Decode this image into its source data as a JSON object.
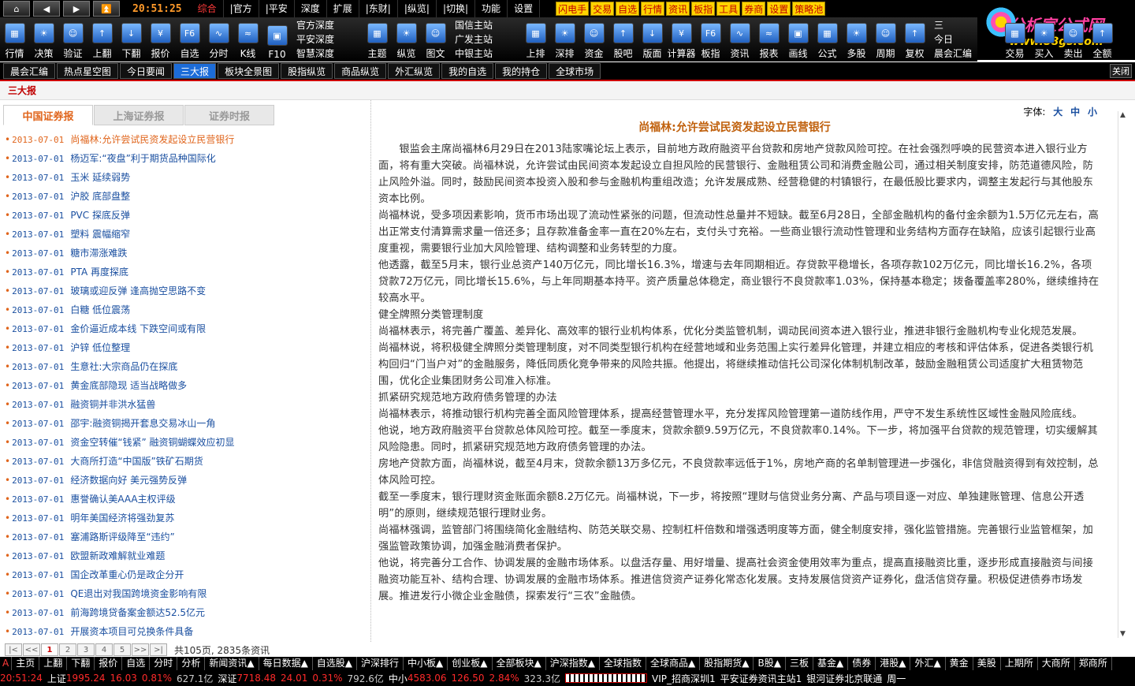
{
  "menubar": {
    "clock": "20:51:25",
    "items": [
      {
        "label": "综合",
        "active": true
      },
      {
        "label": "|官方"
      },
      {
        "label": "|平安"
      },
      {
        "label": "深度"
      },
      {
        "label": "扩展"
      },
      {
        "label": "|东财|"
      },
      {
        "label": "|纵览|"
      },
      {
        "label": "|切换|"
      },
      {
        "label": "功能"
      },
      {
        "label": "设置"
      }
    ],
    "yellow": [
      "闪电手",
      "交易",
      "自选",
      "行情",
      "资讯",
      "板指",
      "工具",
      "券商",
      "设置",
      "策略池"
    ]
  },
  "logo": {
    "line1": "分析家公式网",
    "line2": "www.88gs.com"
  },
  "iconbar": {
    "left": [
      "行情",
      "决策",
      "验证",
      "上翻",
      "下翻",
      "报价",
      "自选",
      "分时",
      "K线",
      "F10"
    ],
    "group1": [
      "官方深度",
      "平安深度",
      "智慧深度"
    ],
    "mid": [
      "主题",
      "纵览",
      "图文"
    ],
    "group2": [
      "国信主站",
      "广发主站",
      "中银主站"
    ],
    "right": [
      "上排",
      "深排",
      "资金",
      "股吧",
      "版面",
      "计算器",
      "板指",
      "资讯",
      "报表",
      "画线",
      "公式",
      "多股",
      "周期",
      "复权"
    ],
    "group3": [
      "三",
      "今日",
      "晨会汇编"
    ],
    "far": [
      "交易",
      "买入",
      "卖出",
      "全额"
    ]
  },
  "tabs": [
    {
      "label": "晨会汇编"
    },
    {
      "label": "热点星空图"
    },
    {
      "label": "今日要闻"
    },
    {
      "label": "三大报",
      "active": true
    },
    {
      "label": "板块全景图"
    },
    {
      "label": "股指纵览"
    },
    {
      "label": "商品纵览"
    },
    {
      "label": "外汇纵览"
    },
    {
      "label": "我的自选"
    },
    {
      "label": "我的持仓"
    },
    {
      "label": "全球市场"
    }
  ],
  "close_label": "关闭",
  "section_title": "三大报",
  "sources": [
    {
      "label": "中国证券报",
      "active": true
    },
    {
      "label": "上海证券报"
    },
    {
      "label": "证券时报"
    }
  ],
  "news": [
    {
      "date": "2013-07-01",
      "title": "尚福林:允许尝试民资发起设立民营银行",
      "active": true
    },
    {
      "date": "2013-07-01",
      "title": "杨迈军:“夜盘”利于期货品种国际化"
    },
    {
      "date": "2013-07-01",
      "title": "玉米 延续弱势"
    },
    {
      "date": "2013-07-01",
      "title": "沪胶 底部盘整"
    },
    {
      "date": "2013-07-01",
      "title": "PVC 探底反弹"
    },
    {
      "date": "2013-07-01",
      "title": "塑料 震幅缩窄"
    },
    {
      "date": "2013-07-01",
      "title": "糖市滞涨难跌"
    },
    {
      "date": "2013-07-01",
      "title": "PTA 再度探底"
    },
    {
      "date": "2013-07-01",
      "title": "玻璃或迎反弹 逢高抛空思路不变"
    },
    {
      "date": "2013-07-01",
      "title": "白糖 低位震荡"
    },
    {
      "date": "2013-07-01",
      "title": "金价逼近成本线 下跌空间或有限"
    },
    {
      "date": "2013-07-01",
      "title": "沪锌 低位整理"
    },
    {
      "date": "2013-07-01",
      "title": "生意社:大宗商品仍在探底"
    },
    {
      "date": "2013-07-01",
      "title": "黄金底部隐现 适当战略做多"
    },
    {
      "date": "2013-07-01",
      "title": "融资铜并非洪水猛兽"
    },
    {
      "date": "2013-07-01",
      "title": "邵宇:融资铜揭开套息交易冰山一角"
    },
    {
      "date": "2013-07-01",
      "title": "资金空转催“钱紧” 融资铜蝴蝶效应初显"
    },
    {
      "date": "2013-07-01",
      "title": "大商所打造“中国版”铁矿石期货"
    },
    {
      "date": "2013-07-01",
      "title": "经济数据向好 美元强势反弹"
    },
    {
      "date": "2013-07-01",
      "title": "惠誉确认美AAA主权评级"
    },
    {
      "date": "2013-07-01",
      "title": "明年美国经济将强劲复苏"
    },
    {
      "date": "2013-07-01",
      "title": "塞浦路斯评级降至“违约”"
    },
    {
      "date": "2013-07-01",
      "title": "欧盟新政难解就业难题"
    },
    {
      "date": "2013-07-01",
      "title": "国企改革重心仍是政企分开"
    },
    {
      "date": "2013-07-01",
      "title": "QE退出对我国跨境资金影响有限"
    },
    {
      "date": "2013-07-01",
      "title": "前海跨境贷备案金额达52.5亿元"
    },
    {
      "date": "2013-07-01",
      "title": "开展资本项目可兑换条件具备"
    }
  ],
  "pager": {
    "buttons": [
      "|<",
      "<<",
      "1",
      "2",
      "3",
      "4",
      "5",
      ">>",
      ">|"
    ],
    "current": "1",
    "info": "共105页, 2835条资讯"
  },
  "fontsize": {
    "label": "字体:",
    "big": "大",
    "mid": "中",
    "small": "小"
  },
  "article": {
    "title": "尚福林:允许尝试民资发起设立民营银行",
    "paragraphs": [
      {
        "text": "银监会主席尚福林6月29日在2013陆家嘴论坛上表示，目前地方政府融资平台贷款和房地产贷款风险可控。在社会强烈呼唤的民营资本进入银行业方面，将有重大突破。尚福林说，允许尝试由民间资本发起设立自担风险的民营银行、金融租赁公司和消费金融公司，通过相关制度安排，防范道德风险，防止风险外溢。同时，鼓励民间资本投资入股和参与金融机构重组改造；允许发展成熟、经营稳健的村镇银行，在最低股比要求内，调整主发起行与其他股东资本比例。",
        "indent": true
      },
      {
        "text": "尚福林说，受多项因素影响，货币市场出现了流动性紧张的问题，但流动性总量并不短缺。截至6月28日，全部金融机构的备付金余额为1.5万亿元左右，高出正常支付清算需求量一倍还多；且存款准备金率一直在20%左右，支付头寸充裕。一些商业银行流动性管理和业务结构方面存在缺陷，应该引起银行业高度重视，需要银行业加大风险管理、结构调整和业务转型的力度。"
      },
      {
        "text": "他透露，截至5月末，银行业总资产140万亿元，同比增长16.3%，增速与去年同期相近。存贷款平稳增长，各项存款102万亿元，同比增长16.2%，各项贷款72万亿元，同比增长15.6%，与上年同期基本持平。资产质量总体稳定，商业银行不良贷款率1.03%，保持基本稳定；拨备覆盖率280%，继续维持在较高水平。"
      },
      {
        "text": "健全牌照分类管理制度"
      },
      {
        "text": "尚福林表示，将完善广覆盖、差异化、高效率的银行业机构体系，优化分类监管机制，调动民间资本进入银行业，推进非银行金融机构专业化规范发展。"
      },
      {
        "text": "尚福林说，将积极健全牌照分类管理制度，对不同类型银行机构在经营地域和业务范围上实行差异化管理，并建立相应的考核和评估体系，促进各类银行机构回归“门当户对”的金融服务，降低同质化竞争带来的风险共振。他提出，将继续推动信托公司深化体制机制改革，鼓励金融租赁公司适度扩大租赁物范围，优化企业集团财务公司准入标准。"
      },
      {
        "text": "抓紧研究规范地方政府债务管理的办法"
      },
      {
        "text": "尚福林表示，将推动银行机构完善全面风险管理体系，提高经营管理水平，充分发挥风险管理第一道防线作用，严守不发生系统性区域性金融风险底线。"
      },
      {
        "text": "他说，地方政府融资平台贷款总体风险可控。截至一季度末，贷款余额9.59万亿元，不良贷款率0.14%。下一步，将加强平台贷款的规范管理，切实缓解其风险隐患。同时，抓紧研究规范地方政府债务管理的办法。"
      },
      {
        "text": "房地产贷款方面，尚福林说，截至4月末，贷款余额13万多亿元，不良贷款率远低于1%，房地产商的名单制管理进一步强化，非信贷融资得到有效控制，总体风险可控。"
      },
      {
        "text": "截至一季度末，银行理财资金账面余额8.2万亿元。尚福林说，下一步，将按照“理财与信贷业务分离、产品与项目逐一对应、单独建账管理、信息公开透明”的原则，继续规范银行理财业务。"
      },
      {
        "text": "尚福林强调，监管部门将围绕简化金融结构、防范关联交易、控制杠杆倍数和增强透明度等方面，健全制度安排，强化监管措施。完善银行业监管框架，加强监管政策协调，加强金融消费者保护。"
      },
      {
        "text": "他说，将完善分工合作、协调发展的金融市场体系。以盘活存量、用好增量、提高社会资金使用效率为重点，提高直接融资比重，逐步形成直接融资与间接融资功能互补、结构合理、协调发展的金融市场体系。推进信贷资产证券化常态化发展。支持发展信贷资产证券化，盘活信贷存量。积极促进债券市场发展。推进发行小微企业金融债，探索发行“三农”金融债。"
      }
    ]
  },
  "bottombar": [
    "主页",
    "上翻",
    "下翻",
    "报价",
    "自选",
    "分时",
    "分析",
    "新闻资讯▲",
    "每日数据▲",
    "自选股▲",
    "沪深排行",
    "中小板▲",
    "创业板▲",
    "全部板块▲",
    "沪深指数▲",
    "全球指数",
    "全球商品▲",
    "股指期货▲",
    "B股▲",
    "三板",
    "基金▲",
    "债券",
    "港股▲",
    "外汇▲",
    "黄金",
    "美股",
    "上期所",
    "大商所",
    "郑商所"
  ],
  "statusbar": {
    "time": "20:51:24",
    "sh_label": "上证",
    "sh_val": "1995.24",
    "sh_chg": "16.03",
    "sh_pct": "0.81%",
    "sh_amt": "627.1亿",
    "sz_label": "深证",
    "sz_val": "7718.48",
    "sz_chg": "24.01",
    "sz_pct": "0.31%",
    "sz_amt": "792.6亿",
    "zx_label": "中小",
    "zx_val": "4583.06",
    "zx_chg": "126.50",
    "zx_pct": "2.84%",
    "zx_amt": "323.3亿",
    "vip": "VIP_招商深圳1",
    "site": "平安证券资讯主站1",
    "bank": "银河证券北京联通",
    "weekday": "周一"
  },
  "colors": {
    "accent_orange": "#e0651c",
    "link_blue": "#1a4fa0",
    "tab_active": "#1c6cd8",
    "menu_red": "#ff3a3a",
    "yellow": "#ffd400"
  }
}
